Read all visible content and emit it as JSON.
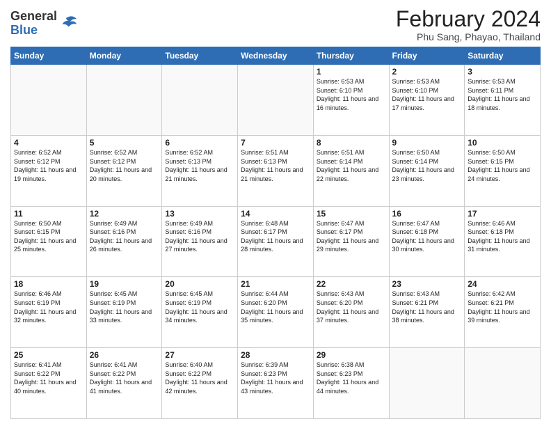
{
  "logo": {
    "general": "General",
    "blue": "Blue"
  },
  "title": "February 2024",
  "location": "Phu Sang, Phayao, Thailand",
  "days_header": [
    "Sunday",
    "Monday",
    "Tuesday",
    "Wednesday",
    "Thursday",
    "Friday",
    "Saturday"
  ],
  "weeks": [
    [
      {
        "day": "",
        "info": ""
      },
      {
        "day": "",
        "info": ""
      },
      {
        "day": "",
        "info": ""
      },
      {
        "day": "",
        "info": ""
      },
      {
        "day": "1",
        "info": "Sunrise: 6:53 AM\nSunset: 6:10 PM\nDaylight: 11 hours and 16 minutes."
      },
      {
        "day": "2",
        "info": "Sunrise: 6:53 AM\nSunset: 6:10 PM\nDaylight: 11 hours and 17 minutes."
      },
      {
        "day": "3",
        "info": "Sunrise: 6:53 AM\nSunset: 6:11 PM\nDaylight: 11 hours and 18 minutes."
      }
    ],
    [
      {
        "day": "4",
        "info": "Sunrise: 6:52 AM\nSunset: 6:12 PM\nDaylight: 11 hours and 19 minutes."
      },
      {
        "day": "5",
        "info": "Sunrise: 6:52 AM\nSunset: 6:12 PM\nDaylight: 11 hours and 20 minutes."
      },
      {
        "day": "6",
        "info": "Sunrise: 6:52 AM\nSunset: 6:13 PM\nDaylight: 11 hours and 21 minutes."
      },
      {
        "day": "7",
        "info": "Sunrise: 6:51 AM\nSunset: 6:13 PM\nDaylight: 11 hours and 21 minutes."
      },
      {
        "day": "8",
        "info": "Sunrise: 6:51 AM\nSunset: 6:14 PM\nDaylight: 11 hours and 22 minutes."
      },
      {
        "day": "9",
        "info": "Sunrise: 6:50 AM\nSunset: 6:14 PM\nDaylight: 11 hours and 23 minutes."
      },
      {
        "day": "10",
        "info": "Sunrise: 6:50 AM\nSunset: 6:15 PM\nDaylight: 11 hours and 24 minutes."
      }
    ],
    [
      {
        "day": "11",
        "info": "Sunrise: 6:50 AM\nSunset: 6:15 PM\nDaylight: 11 hours and 25 minutes."
      },
      {
        "day": "12",
        "info": "Sunrise: 6:49 AM\nSunset: 6:16 PM\nDaylight: 11 hours and 26 minutes."
      },
      {
        "day": "13",
        "info": "Sunrise: 6:49 AM\nSunset: 6:16 PM\nDaylight: 11 hours and 27 minutes."
      },
      {
        "day": "14",
        "info": "Sunrise: 6:48 AM\nSunset: 6:17 PM\nDaylight: 11 hours and 28 minutes."
      },
      {
        "day": "15",
        "info": "Sunrise: 6:47 AM\nSunset: 6:17 PM\nDaylight: 11 hours and 29 minutes."
      },
      {
        "day": "16",
        "info": "Sunrise: 6:47 AM\nSunset: 6:18 PM\nDaylight: 11 hours and 30 minutes."
      },
      {
        "day": "17",
        "info": "Sunrise: 6:46 AM\nSunset: 6:18 PM\nDaylight: 11 hours and 31 minutes."
      }
    ],
    [
      {
        "day": "18",
        "info": "Sunrise: 6:46 AM\nSunset: 6:19 PM\nDaylight: 11 hours and 32 minutes."
      },
      {
        "day": "19",
        "info": "Sunrise: 6:45 AM\nSunset: 6:19 PM\nDaylight: 11 hours and 33 minutes."
      },
      {
        "day": "20",
        "info": "Sunrise: 6:45 AM\nSunset: 6:19 PM\nDaylight: 11 hours and 34 minutes."
      },
      {
        "day": "21",
        "info": "Sunrise: 6:44 AM\nSunset: 6:20 PM\nDaylight: 11 hours and 35 minutes."
      },
      {
        "day": "22",
        "info": "Sunrise: 6:43 AM\nSunset: 6:20 PM\nDaylight: 11 hours and 37 minutes."
      },
      {
        "day": "23",
        "info": "Sunrise: 6:43 AM\nSunset: 6:21 PM\nDaylight: 11 hours and 38 minutes."
      },
      {
        "day": "24",
        "info": "Sunrise: 6:42 AM\nSunset: 6:21 PM\nDaylight: 11 hours and 39 minutes."
      }
    ],
    [
      {
        "day": "25",
        "info": "Sunrise: 6:41 AM\nSunset: 6:22 PM\nDaylight: 11 hours and 40 minutes."
      },
      {
        "day": "26",
        "info": "Sunrise: 6:41 AM\nSunset: 6:22 PM\nDaylight: 11 hours and 41 minutes."
      },
      {
        "day": "27",
        "info": "Sunrise: 6:40 AM\nSunset: 6:22 PM\nDaylight: 11 hours and 42 minutes."
      },
      {
        "day": "28",
        "info": "Sunrise: 6:39 AM\nSunset: 6:23 PM\nDaylight: 11 hours and 43 minutes."
      },
      {
        "day": "29",
        "info": "Sunrise: 6:38 AM\nSunset: 6:23 PM\nDaylight: 11 hours and 44 minutes."
      },
      {
        "day": "",
        "info": ""
      },
      {
        "day": "",
        "info": ""
      }
    ]
  ]
}
